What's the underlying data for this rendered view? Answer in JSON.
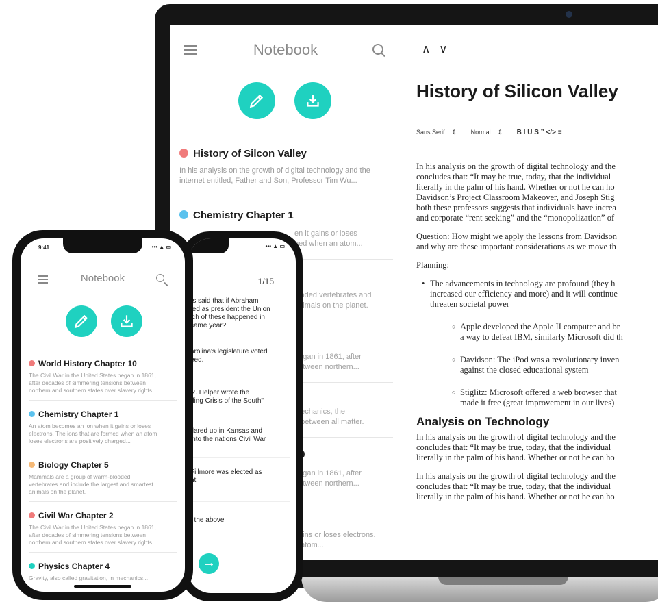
{
  "notebook": {
    "title": "Notebook",
    "notes": [
      {
        "title": "History of Silcon Valley",
        "excerpt": "In his analysis on the growth of digital technology and the internet entitled, Father and Son, Professor Tim Wu...",
        "color": "#f07b7b"
      },
      {
        "title": "Chemistry Chapter 1",
        "excerpt": "",
        "color": "#5bc2ee"
      }
    ],
    "fragments": [
      "en it gains or loses",
      "ned when an atom...",
      "looded vertebrates and",
      "animals on the planet.",
      "began in 1861, after",
      "between northern...",
      "mechanics, the",
      "g between all matter.",
      "10",
      "began in 1861, after",
      "between northern...",
      "gains or loses electrons.",
      "n atom..."
    ]
  },
  "editor": {
    "nav_arrows": "∧ ∨",
    "doc_title": "History of Silicon Valley",
    "toolbar": {
      "font": "Sans Serif",
      "size": "Normal",
      "buttons": "B  I  U  S  ”  </>  ≡"
    },
    "p1": [
      "In his analysis on the growth of digital technology and the",
      "concludes that: “It may be true, today, that the individual",
      "literally in the palm of his hand. Whether or not he can ho",
      "Davidson’s Project Classroom Makeover, and Joseph Stig",
      "both these professors suggests that individuals have increa",
      "and corporate “rent seeking” and the “monopolization” of"
    ],
    "p2": [
      "Question: How might we apply the lessons from Davidson",
      "and why are these important considerations as we move th"
    ],
    "planning": "Planning:",
    "bullet": [
      "The advancements in technology are profound (they h",
      "increased our efficiency and more) and it will continue",
      "threaten societal power"
    ],
    "sub1": [
      "Apple developed the Apple II computer and br",
      "a way to defeat IBM, similarly Microsoft did th"
    ],
    "sub2": [
      "Davidson: The iPod was a revolutionary inven",
      "against the closed educational system"
    ],
    "sub3": [
      "Stiglitz: Microsoft offered a web browser that",
      "made it free (great improvement in our lives)"
    ],
    "heading2": "Analysis on Technology",
    "p3": [
      "In his analysis on the growth of digital technology and the",
      "concludes that: “It may be true, today, that the individual",
      "literally in the palm of his hand. Whether or not he can ho"
    ],
    "p4": [
      "In his analysis on the growth of digital technology and the",
      "concludes that: “It may be true, today, that the individual",
      "literally in the palm of his hand. Whether or not he can ho"
    ]
  },
  "quiz": {
    "counter": "1/15",
    "questions": [
      [
        "rs said that if Abraham",
        "ted as president the Union",
        "ich of these happened in",
        "same year?"
      ],
      [
        "arolina's legislature voted",
        "eed."
      ],
      [
        "R. Helper wrote the",
        "ding Crisis of the South\""
      ],
      [
        "flared up in Kansas and",
        "into the nations Civil War"
      ],
      [
        "Fillmore was elected as",
        "nt"
      ],
      [
        "f the above"
      ]
    ],
    "next_icon": "arrow-right-icon"
  },
  "phone": {
    "time": "9:41",
    "status": "••• ▲ ▭",
    "title": "Notebook",
    "notes": [
      {
        "title": "World History Chapter 10",
        "excerpt": [
          "The Civil War in the United States began in 1861,",
          "after decades of simmering tensions between",
          "northern and southern states over slavery rights..."
        ],
        "color": "#f07b7b"
      },
      {
        "title": "Chemistry Chapter 1",
        "excerpt": [
          "An atom becomes an ion when it gains or loses",
          "electrons. The ions that are formed when an atom",
          "loses electrons are positively charged..."
        ],
        "color": "#5bc2ee"
      },
      {
        "title": "Biology Chapter 5",
        "excerpt": [
          "Mammals are a group of warm-blooded",
          "vertebrates and include the largest and smartest",
          "animals on the planet."
        ],
        "color": "#f5b977"
      },
      {
        "title": "Civil War Chapter 2",
        "excerpt": [
          "The Civil War in the United States began in 1861,",
          "after decades of simmering tensions between",
          "northern and southern states over slavery rights..."
        ],
        "color": "#f07b7b"
      },
      {
        "title": "Physics Chapter 4",
        "excerpt": [
          "Gravity, also called gravitation, in mechanics..."
        ],
        "color": "#1fd1c0"
      }
    ]
  },
  "colors": {
    "accent": "#1fd1c0"
  }
}
